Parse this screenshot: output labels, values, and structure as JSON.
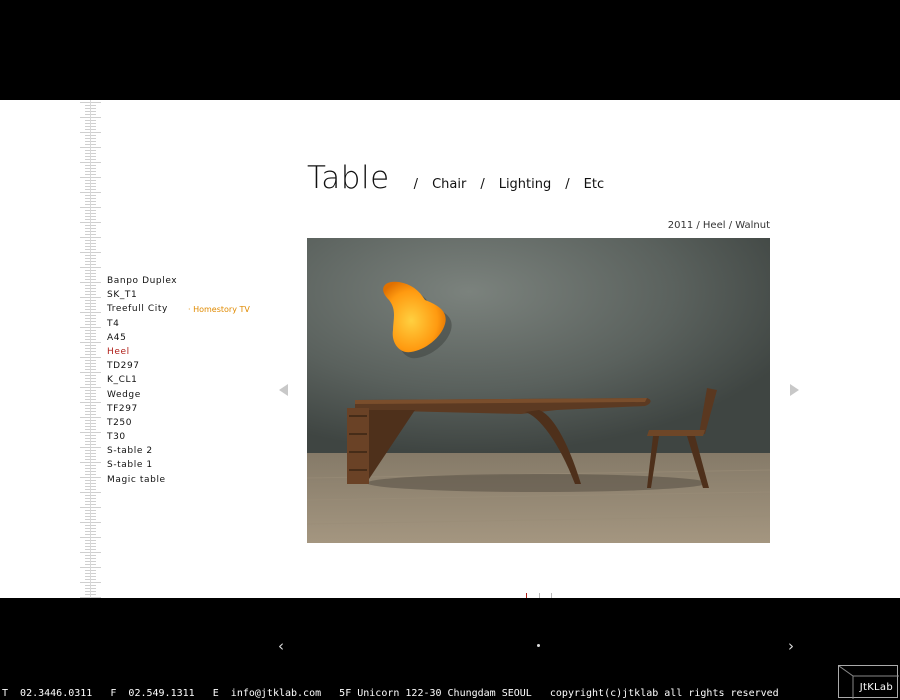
{
  "category_nav": {
    "title": "Table",
    "links": [
      "Chair",
      "Lighting",
      "Etc"
    ],
    "separator": "/"
  },
  "caption": "2011 / Heel / Walnut",
  "products": [
    {
      "label": "Banpo Duplex",
      "active": false
    },
    {
      "label": "SK_T1",
      "active": false
    },
    {
      "label": "Treefull City",
      "active": false,
      "tag": "· Homestory TV"
    },
    {
      "label": "T4",
      "active": false
    },
    {
      "label": "A45",
      "active": false
    },
    {
      "label": "Heel",
      "active": true
    },
    {
      "label": "TD297",
      "active": false
    },
    {
      "label": "K_CL1",
      "active": false
    },
    {
      "label": "Wedge",
      "active": false
    },
    {
      "label": "TF297",
      "active": false
    },
    {
      "label": "T250",
      "active": false
    },
    {
      "label": "T30",
      "active": false
    },
    {
      "label": "S-table 2",
      "active": false
    },
    {
      "label": "S-table 1",
      "active": false
    },
    {
      "label": "Magic table",
      "active": false
    }
  ],
  "icons": {
    "prev": "triangle-left-icon",
    "next": "triangle-right-icon",
    "bottom_prev": "chevron-left-icon",
    "bottom_next": "chevron-right-icon"
  },
  "footer": {
    "tel": "T  02.3446.0311",
    "fax": "F  02.549.1311",
    "email": "E  info@jtklab.com",
    "address": "5F Unicorn 122-30 Chungdam SEOUL",
    "copyright": "copyright(c)jtklab all rights reserved"
  },
  "logo": "JtKLab",
  "colors": {
    "active": "#b0201a",
    "tag": "#e08a00",
    "background": "#000000"
  }
}
